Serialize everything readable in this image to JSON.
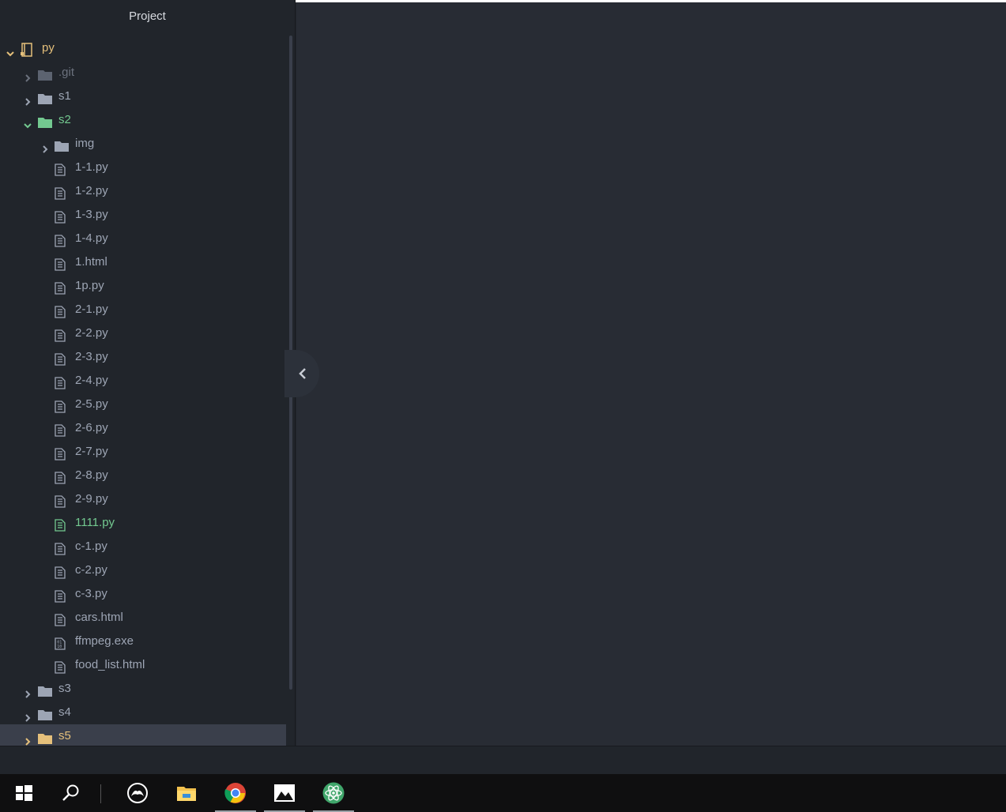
{
  "panel": {
    "title": "Project"
  },
  "tree": {
    "root": {
      "label": "py"
    },
    "folders_top": [
      {
        "label": ".git",
        "state": "collapsed",
        "ignored": true
      },
      {
        "label": "s1",
        "state": "collapsed"
      }
    ],
    "open_folder": {
      "label": "s2",
      "state": "expanded"
    },
    "subfolder": {
      "label": "img",
      "state": "collapsed"
    },
    "files": [
      {
        "label": "1-1.py"
      },
      {
        "label": "1-2.py"
      },
      {
        "label": "1-3.py"
      },
      {
        "label": "1-4.py"
      },
      {
        "label": "1.html"
      },
      {
        "label": "1p.py"
      },
      {
        "label": "2-1.py"
      },
      {
        "label": "2-2.py"
      },
      {
        "label": "2-3.py"
      },
      {
        "label": "2-4.py"
      },
      {
        "label": "2-5.py"
      },
      {
        "label": "2-6.py"
      },
      {
        "label": "2-7.py"
      },
      {
        "label": "2-8.py"
      },
      {
        "label": "2-9.py"
      },
      {
        "label": "1111.py",
        "status": "new"
      },
      {
        "label": "c-1.py"
      },
      {
        "label": "c-2.py"
      },
      {
        "label": "c-3.py"
      },
      {
        "label": "cars.html"
      },
      {
        "label": "ffmpeg.exe",
        "kind": "binary"
      },
      {
        "label": "food_list.html"
      }
    ],
    "folders_bottom": [
      {
        "label": "s3",
        "state": "collapsed"
      },
      {
        "label": "s4",
        "state": "collapsed"
      },
      {
        "label": "s5",
        "state": "collapsed",
        "selected": true,
        "modified": true
      }
    ]
  },
  "taskbar": {
    "items": [
      "windows-start-icon",
      "search-icon",
      "game-controller-icon",
      "file-explorer-icon",
      "chrome-icon",
      "photos-icon",
      "atom-icon"
    ]
  },
  "colors": {
    "sidebar_bg": "#21252b",
    "editor_bg": "#282c34",
    "text": "#9da5b4",
    "added": "#73c990",
    "modified": "#e5c07b",
    "ignored": "#6b717d",
    "selected_row": "#3a3f4b"
  }
}
